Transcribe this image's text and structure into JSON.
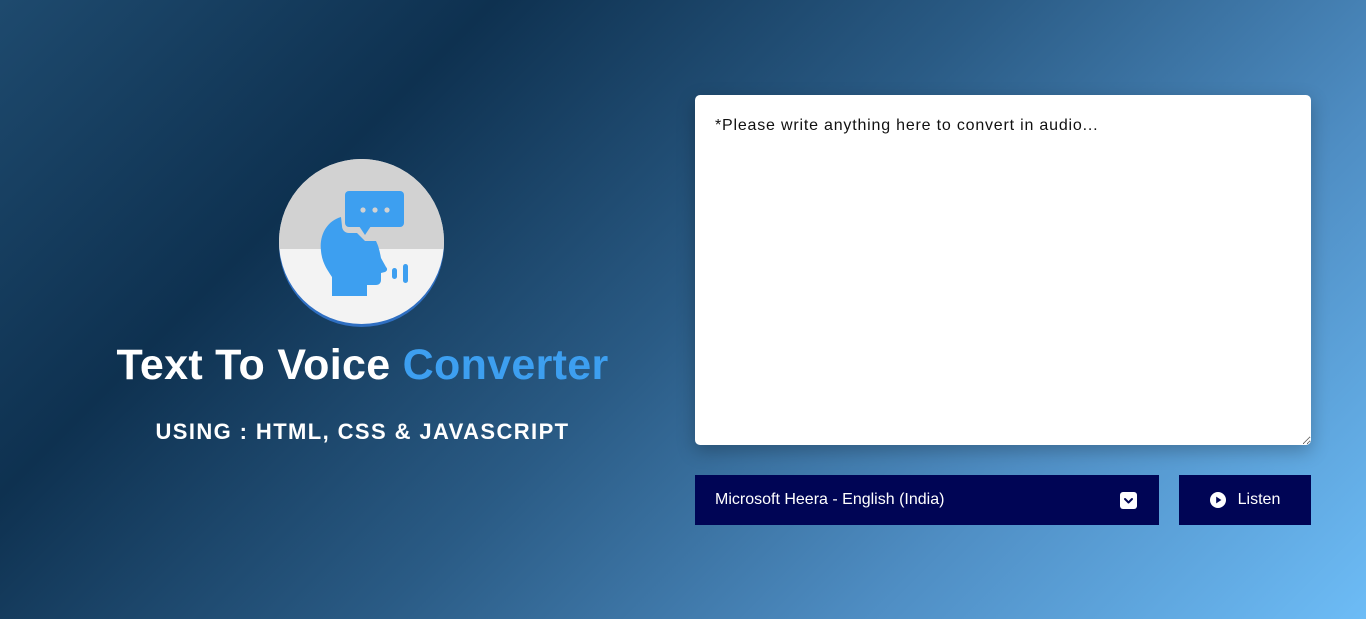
{
  "hero": {
    "title_main": "Text To Voice",
    "title_accent": "Converter",
    "subtitle": "USING : HTML, CSS & JAVASCRIPT",
    "logo_icon": "speaking-head-icon"
  },
  "editor": {
    "placeholder": "*Please write anything here to convert in audio..."
  },
  "voice_select": {
    "selected": "Microsoft Heera - English (India)",
    "icon": "chevron-down-icon"
  },
  "listen_button": {
    "label": "Listen",
    "icon": "play-icon"
  },
  "colors": {
    "accent": "#3d9ff0",
    "button_bg": "#000555",
    "text_light": "#ffffff"
  }
}
